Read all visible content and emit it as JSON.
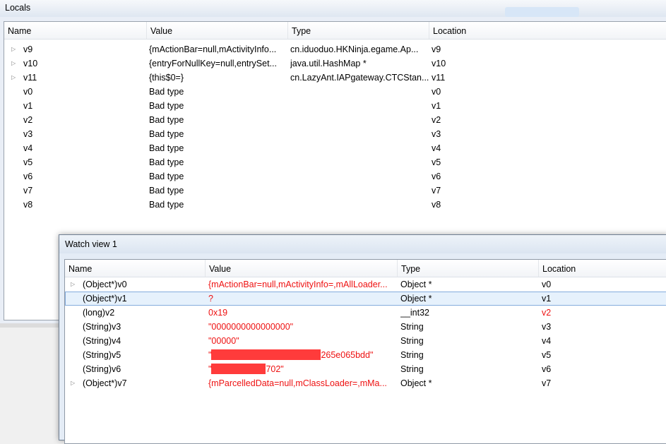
{
  "locals": {
    "title": "Locals",
    "columns": [
      "Name",
      "Value",
      "Type",
      "Location"
    ],
    "rows": [
      {
        "name": "v9",
        "value": "{mActionBar=null,mActivityInfo...",
        "type": "cn.iduoduo.HKNinja.egame.Ap...",
        "location": "v9",
        "expandable": true
      },
      {
        "name": "v10",
        "value": "{entryForNullKey=null,entrySet...",
        "type": "java.util.HashMap *",
        "location": "v10",
        "expandable": true
      },
      {
        "name": "v11",
        "value": "{this$0=}",
        "type": "cn.LazyAnt.IAPgateway.CTCStan...",
        "location": "v11",
        "expandable": true
      },
      {
        "name": "v0",
        "value": "Bad type",
        "type": "",
        "location": "v0",
        "expandable": false
      },
      {
        "name": "v1",
        "value": "Bad type",
        "type": "",
        "location": "v1",
        "expandable": false
      },
      {
        "name": "v2",
        "value": "Bad type",
        "type": "",
        "location": "v2",
        "expandable": false
      },
      {
        "name": "v3",
        "value": "Bad type",
        "type": "",
        "location": "v3",
        "expandable": false
      },
      {
        "name": "v4",
        "value": "Bad type",
        "type": "",
        "location": "v4",
        "expandable": false
      },
      {
        "name": "v5",
        "value": "Bad type",
        "type": "",
        "location": "v5",
        "expandable": false
      },
      {
        "name": "v6",
        "value": "Bad type",
        "type": "",
        "location": "v6",
        "expandable": false
      },
      {
        "name": "v7",
        "value": "Bad type",
        "type": "",
        "location": "v7",
        "expandable": false
      },
      {
        "name": "v8",
        "value": "Bad type",
        "type": "",
        "location": "v8",
        "expandable": false
      }
    ]
  },
  "watch": {
    "title": "Watch view 1",
    "columns": [
      "Name",
      "Value",
      "Type",
      "Location"
    ],
    "rows": [
      {
        "name": "(Object*)v0",
        "value": "{mActionBar=null,mActivityInfo=,mAllLoader...",
        "type": "Object *",
        "location": "v0",
        "expandable": true,
        "value_red": true,
        "location_red": false
      },
      {
        "name": "(Object*)v1",
        "value": "?",
        "type": "Object *",
        "location": "v1",
        "expandable": false,
        "value_red": true,
        "location_red": false,
        "selected": true
      },
      {
        "name": "(long)v2",
        "value": "0x19",
        "type": "__int32",
        "location": "v2",
        "expandable": false,
        "value_red": true,
        "location_red": true
      },
      {
        "name": "(String)v3",
        "value": "\"0000000000000000\"",
        "type": "String",
        "location": "v3",
        "expandable": false,
        "value_red": true,
        "location_red": false
      },
      {
        "name": "(String)v4",
        "value": "\"00000\"",
        "type": "String",
        "location": "v4",
        "expandable": false,
        "value_red": true,
        "location_red": false
      },
      {
        "name": "(String)v5",
        "value_prefix": "\"",
        "value": "265e065bdd\"",
        "type": "String",
        "location": "v5",
        "expandable": false,
        "value_red": true,
        "location_red": false,
        "redacted": true,
        "redaction_fraction": 0.72
      },
      {
        "name": "(String)v6",
        "value_prefix": "\"",
        "value": "702\"",
        "type": "String",
        "location": "v6",
        "expandable": false,
        "value_red": true,
        "location_red": false,
        "redacted": true,
        "redaction_fraction": 0.36
      },
      {
        "name": "(Object*)v7",
        "value": "{mParcelledData=null,mClassLoader=,mMa...",
        "type": "Object *",
        "location": "v7",
        "expandable": true,
        "value_red": true,
        "location_red": false
      }
    ]
  },
  "colors": {
    "value_changed": "#e11111",
    "redaction": "#ff3b3b",
    "selection": "#e6f1fc"
  },
  "icons": {
    "expander": "triangle-right"
  }
}
